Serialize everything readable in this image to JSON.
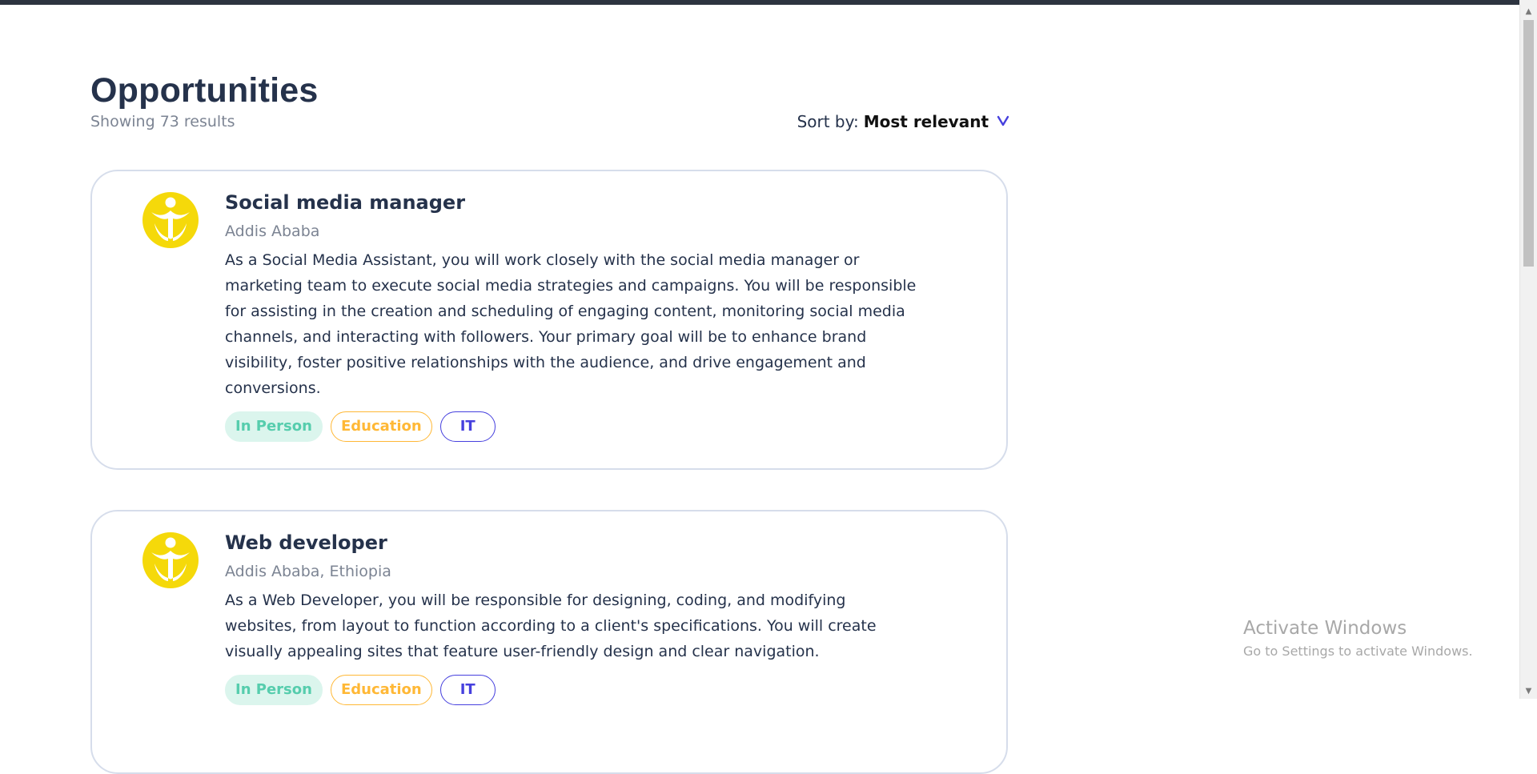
{
  "header": {
    "title": "Opportunities",
    "results_text": "Showing 73 results",
    "sort_label": "Sort by:",
    "sort_value": "Most relevant"
  },
  "jobs": [
    {
      "title": "Social media manager",
      "location": "Addis Ababa",
      "description": "As a Social Media Assistant, you will work closely with the social media manager or marketing team to execute social media strategies and campaigns. You will be responsible for assisting in the creation and scheduling of engaging content, monitoring social media channels, and interacting with followers. Your primary goal will be to enhance brand visibility, foster positive relationships with the audience, and drive engagement and conversions.",
      "tags": [
        "In Person",
        "Education",
        "IT"
      ]
    },
    {
      "title": "Web developer",
      "location": "Addis Ababa, Ethiopia",
      "description": "As a Web Developer, you will be responsible for designing, coding, and modifying websites, from layout to function according to a client's specifications. You will create visually appealing sites that feature user-friendly design and clear navigation.",
      "tags": [
        "In Person",
        "Education",
        "IT"
      ]
    }
  ],
  "watermark": {
    "title": "Activate Windows",
    "subtitle": "Go to Settings to activate Windows."
  },
  "colors": {
    "primary_text": "#25324b",
    "muted_text": "#7c8493",
    "accent": "#4640de",
    "tag_green": "#56cdad",
    "tag_orange": "#ffb836",
    "logo_yellow": "#f5d90a"
  }
}
